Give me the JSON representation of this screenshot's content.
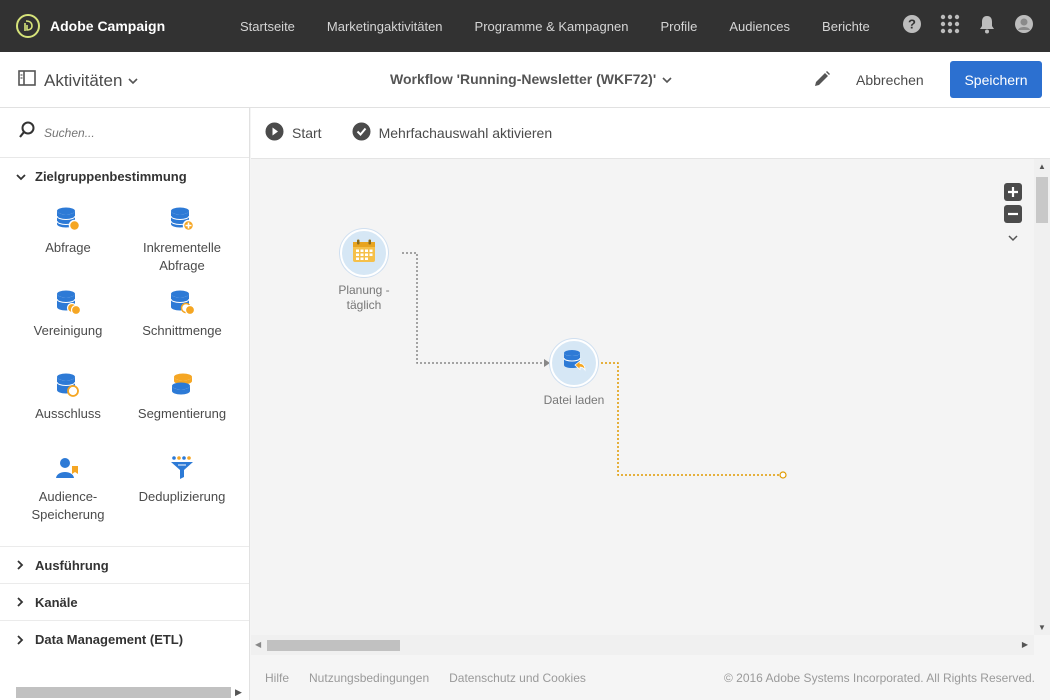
{
  "app": {
    "brand": "Adobe Campaign"
  },
  "nav": {
    "items": [
      "Startseite",
      "Marketingaktivitäten",
      "Programme & Kampagnen",
      "Profile",
      "Audiences",
      "Berichte"
    ]
  },
  "topicons": [
    "help-icon",
    "apps-grid-icon",
    "bell-icon",
    "user-avatar-icon"
  ],
  "subheader": {
    "activities_label": "Aktivitäten",
    "workflow_title": "Workflow 'Running-Newsletter (WKF72)'",
    "cancel_label": "Abbrechen",
    "save_label": "Speichern"
  },
  "sidebar": {
    "search_placeholder": "Suchen...",
    "sections": [
      {
        "label": "Zielgruppenbestimmung",
        "expanded": true
      },
      {
        "label": "Ausführung",
        "expanded": false
      },
      {
        "label": "Kanäle",
        "expanded": false
      },
      {
        "label": "Data Management (ETL)",
        "expanded": false
      }
    ],
    "tiles": [
      {
        "label": "Abfrage",
        "icon": "database-query-icon"
      },
      {
        "label": "Inkrementelle Abfrage",
        "icon": "database-incremental-icon"
      },
      {
        "label": "Vereinigung",
        "icon": "database-union-icon"
      },
      {
        "label": "Schnittmenge",
        "icon": "database-intersection-icon"
      },
      {
        "label": "Ausschluss",
        "icon": "database-exclusion-icon"
      },
      {
        "label": "Segmentierung",
        "icon": "database-segmentation-icon"
      },
      {
        "label": "Audience-Speicherung",
        "icon": "audience-save-icon"
      },
      {
        "label": "Deduplizierung",
        "icon": "deduplication-funnel-icon"
      }
    ]
  },
  "toolbar": {
    "start_label": "Start",
    "multiselect_label": "Mehrfachauswahl aktivieren"
  },
  "canvas": {
    "nodes": [
      {
        "label": "Planung - täglich",
        "icon": "calendar-icon"
      },
      {
        "label": "Datei laden",
        "icon": "file-load-icon"
      }
    ]
  },
  "footer": {
    "links": [
      "Hilfe",
      "Nutzungsbedingungen",
      "Datenschutz und Cookies"
    ],
    "copyright": "© 2016 Adobe Systems Incorporated. All Rights Reserved."
  },
  "colors": {
    "topbar": "#323232",
    "accent": "#2c70d0",
    "node_bg": "#d6e7f5",
    "orange": "#f5a623",
    "blue_icon": "#2d7ad6"
  }
}
